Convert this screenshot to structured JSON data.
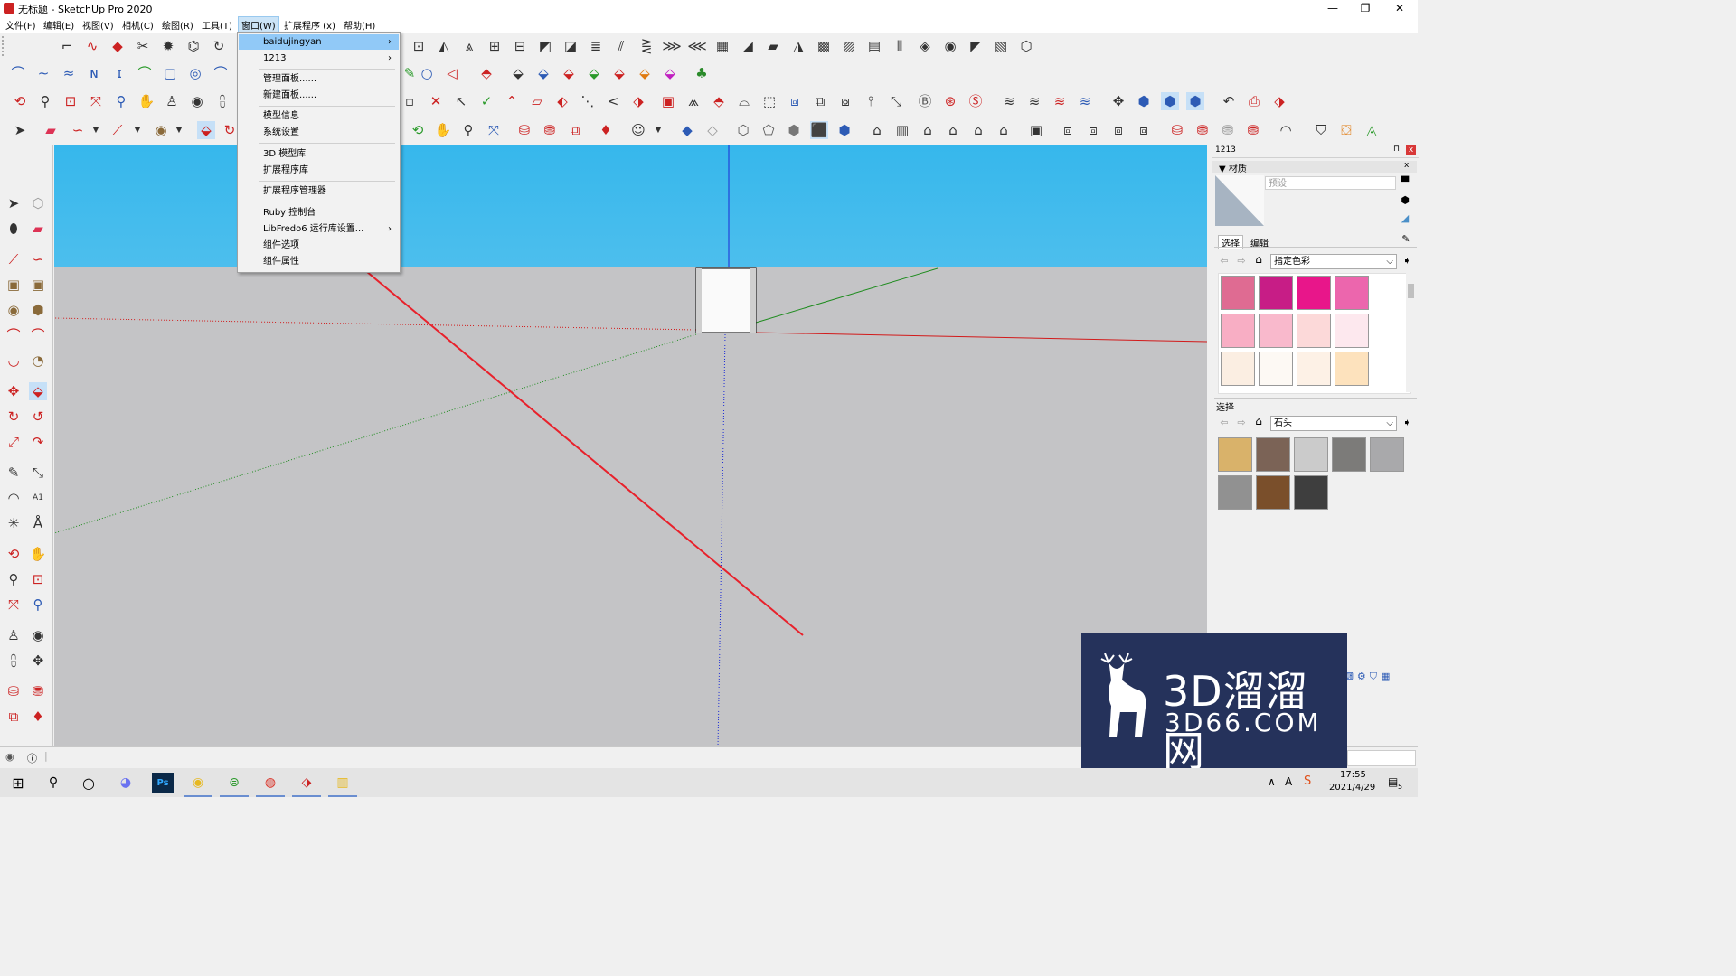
{
  "window": {
    "title": "无标题 - SketchUp Pro 2020",
    "minimize": "—",
    "restore": "❐",
    "close": "✕"
  },
  "menubar": {
    "items": [
      "文件(F)",
      "编辑(E)",
      "视图(V)",
      "相机(C)",
      "绘图(R)",
      "工具(T)",
      "窗口(W)",
      "扩展程序 (x)",
      "帮助(H)"
    ]
  },
  "window_menu": {
    "items": [
      {
        "label": "baidujingyan",
        "submenu": true,
        "highlighted": true
      },
      {
        "label": "1213",
        "submenu": true
      },
      {
        "label": "管理面板......"
      },
      {
        "label": "新建面板......"
      },
      {
        "label": "模型信息"
      },
      {
        "label": "系统设置"
      },
      {
        "label": "3D 模型库"
      },
      {
        "label": "扩展程序库"
      },
      {
        "label": "扩展程序管理器"
      },
      {
        "label": "Ruby 控制台"
      },
      {
        "label": "LibFredo6 运行库设置...",
        "submenu": true
      },
      {
        "label": "组件选项"
      },
      {
        "label": "组件属性"
      }
    ],
    "arrow": "›"
  },
  "tray": {
    "title": "1213",
    "pin": "⊓",
    "close": "x",
    "materials_header": "▼ 材质",
    "material_name_placeholder": "预设",
    "tab_select": "选择",
    "tab_edit": "编辑",
    "library1": "指定色彩",
    "section2_label": "选择",
    "library2": "石头",
    "dropdown_arrow": "⌵",
    "colors_top": [
      "#df6b92",
      "#c71d86",
      "#e8168a",
      "#ec66ad",
      "#f8aec4",
      "#f9b9cc",
      "#fcd9d9",
      "#fde8ee",
      "#fbeee2",
      "#fdf9f4",
      "#fdf1e6",
      "#fde2bd"
    ],
    "colors_bottom": [
      "#d9b26a",
      "#7b6356",
      "#cbcbcb",
      "#7c7b79",
      "#a9a9ab",
      "#919191",
      "#7a4f2b",
      "#3e3e3e"
    ]
  },
  "watermark": {
    "line1": "3D溜溜网",
    "line2": "3D66.COM"
  },
  "statusbar": {
    "icon1": "◉",
    "icon2": "ⓘ",
    "divider": "|"
  },
  "taskbar": {
    "start": "⊞",
    "search": "⚲",
    "taskview": "○",
    "time": "17:55",
    "date": "2021/4/29",
    "notification_count": "5",
    "tray_chevron": "∧",
    "ime": "A"
  },
  "colors": {
    "sky_top": "#36b7ec",
    "ground": "#c4c4c6",
    "menu_highlight": "#91c9f7",
    "annotation_arrow": "#e8212b",
    "watermark_bg": "#25325b"
  }
}
